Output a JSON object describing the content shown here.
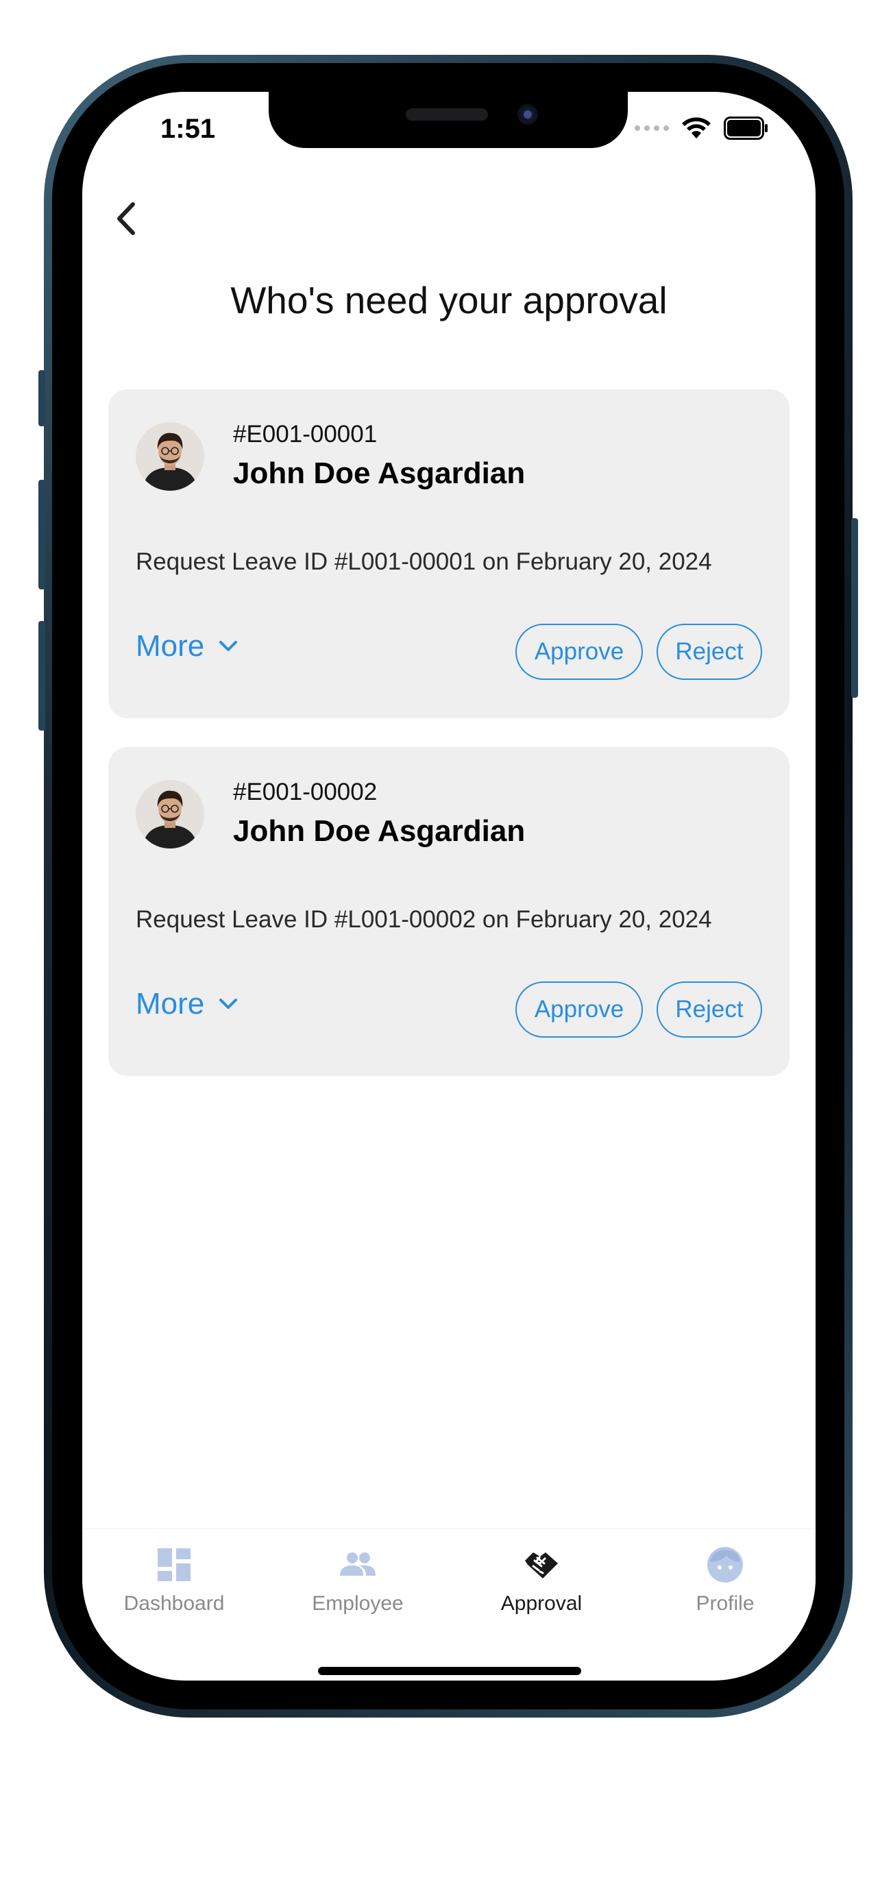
{
  "status_bar": {
    "time": "1:51"
  },
  "header": {
    "title": "Who's need your approval"
  },
  "approvals": [
    {
      "employee_id": "#E001-00001",
      "name": "John Doe Asgardian",
      "request": "Request Leave ID #L001-00001 on February 20, 2024",
      "more_label": "More",
      "approve_label": "Approve",
      "reject_label": "Reject"
    },
    {
      "employee_id": "#E001-00002",
      "name": "John Doe Asgardian",
      "request": "Request Leave ID #L001-00002 on February 20, 2024",
      "more_label": "More",
      "approve_label": "Approve",
      "reject_label": "Reject"
    }
  ],
  "tabbar": {
    "items": [
      {
        "label": "Dashboard",
        "icon": "dashboard-icon",
        "active": false
      },
      {
        "label": "Employee",
        "icon": "people-icon",
        "active": false
      },
      {
        "label": "Approval",
        "icon": "handshake-icon",
        "active": true
      },
      {
        "label": "Profile",
        "icon": "face-icon",
        "active": false
      }
    ]
  },
  "colors": {
    "accent": "#2a8de0",
    "card_bg": "#efefef",
    "inactive_icon": "#b7c9e6",
    "active_icon": "#1a1a1a"
  }
}
